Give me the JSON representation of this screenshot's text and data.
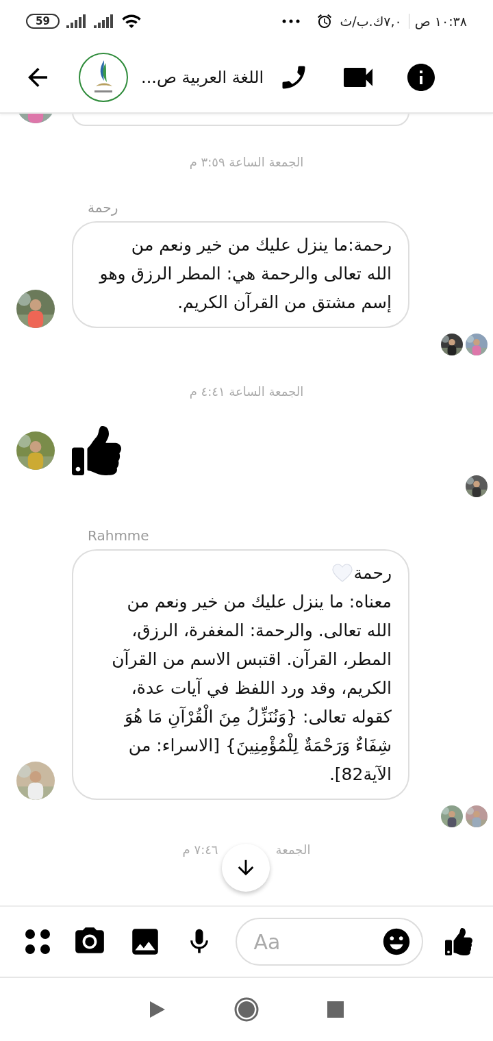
{
  "status_bar": {
    "battery": "59",
    "time": "١٠:٣٨ ص",
    "speed": "٧,٠ك.ب/ث"
  },
  "header": {
    "title": "اللغة العربية ص..."
  },
  "feed": [
    {
      "kind": "clipped_bubble"
    },
    {
      "kind": "timestamp",
      "text": "الجمعة الساعة ٣:٥٩ م"
    },
    {
      "kind": "message",
      "sender": "رحمة",
      "lines": [
        "رحمة:ما ينزل عليك من خير ونعم من",
        "الله تعالى والرحمة هي: المطر الرزق وهو",
        "إسم مشتق من القرآن الكريم."
      ]
    },
    {
      "kind": "timestamp",
      "text": "الجمعة الساعة ٤:٤١ م"
    },
    {
      "kind": "like"
    },
    {
      "kind": "message",
      "sender": "Rahmme",
      "title": "رحمة",
      "title_heart": true,
      "lines": [
        "معناه: ما ينزل عليك من خير ونعم من",
        "الله تعالى. والرحمة: المغفرة، الرزق،",
        "المطر، القرآن. اقتبس الاسم من القرآن",
        "الكريم، وقد ورد اللفظ في آيات عدة،",
        "كقوله تعالى: {وَنُنَزِّلُ مِنَ الْقُرْآنِ مَا هُوَ",
        "شِفَاءٌ وَرَحْمَةٌ لِلْمُؤْمِنِينَ} [الاسراء: من",
        "الآية82]."
      ]
    },
    {
      "kind": "timestamp_partial",
      "parts": [
        "الجمعة",
        "٧:٤٦ م"
      ]
    }
  ],
  "composer": {
    "placeholder": "Aa"
  }
}
